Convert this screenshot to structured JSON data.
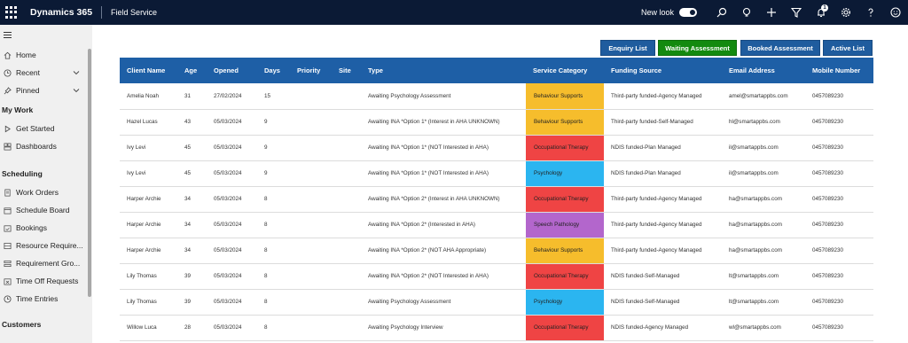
{
  "topbar": {
    "brand": "Dynamics 365",
    "app_name": "Field Service",
    "new_look_label": "New look",
    "notification_count": "1"
  },
  "sidebar": {
    "items_top": [
      {
        "label": "Home",
        "icon": "home-icon"
      },
      {
        "label": "Recent",
        "icon": "clock-icon"
      },
      {
        "label": "Pinned",
        "icon": "pin-icon"
      }
    ],
    "section_my_work": "My Work",
    "items_my_work": [
      {
        "label": "Get Started",
        "icon": "play-icon"
      },
      {
        "label": "Dashboards",
        "icon": "dashboard-icon"
      }
    ],
    "section_scheduling": "Scheduling",
    "items_scheduling": [
      {
        "label": "Work Orders",
        "icon": "document-icon"
      },
      {
        "label": "Schedule Board",
        "icon": "calendar-icon"
      },
      {
        "label": "Bookings",
        "icon": "calendar-check-icon"
      },
      {
        "label": "Resource Require...",
        "icon": "requirement-icon"
      },
      {
        "label": "Requirement Gro...",
        "icon": "group-icon"
      },
      {
        "label": "Time Off Requests",
        "icon": "calendar-x-icon"
      },
      {
        "label": "Time Entries",
        "icon": "clock-icon"
      }
    ],
    "section_customers": "Customers"
  },
  "buttons": {
    "enquiry": "Enquiry List",
    "waiting": "Waiting Assessment",
    "booked": "Booked Assessment",
    "active": "Active List"
  },
  "table": {
    "headers": [
      "Client Name",
      "Age",
      "Opened",
      "Days",
      "Priority",
      "Site",
      "Type",
      "Service Category",
      "Funding Source",
      "Email Address",
      "Mobile Number"
    ],
    "rows": [
      {
        "name": "Amelia Noah",
        "age": "31",
        "opened": "27/02/2024",
        "days": "15",
        "priority": "",
        "site": "",
        "type": "Awaiting Psychology Assessment",
        "category": "Behaviour Supports",
        "cat_color": "#f6bd2c",
        "funding": "Third-party funded-Agency Managed",
        "email": "amel@smartappbs.com",
        "mobile": "0457089230"
      },
      {
        "name": "Hazel Lucas",
        "age": "43",
        "opened": "05/03/2024",
        "days": "9",
        "priority": "",
        "site": "",
        "type": "Awaiting INA *Option 1* (Interest in AHA UNKNOWN)",
        "category": "Behaviour Supports",
        "cat_color": "#f6bd2c",
        "funding": "Third-party funded-Self-Managed",
        "email": "hl@smartappbs.com",
        "mobile": "0457089230"
      },
      {
        "name": "Ivy Levi",
        "age": "45",
        "opened": "05/03/2024",
        "days": "9",
        "priority": "",
        "site": "",
        "type": "Awaiting INA *Option 1* (NOT Interested in AHA)",
        "category": "Occupational Therapy",
        "cat_color": "#ef4444",
        "funding": "NDIS funded-Plan Managed",
        "email": "il@smartappbs.com",
        "mobile": "0457089230"
      },
      {
        "name": "Ivy Levi",
        "age": "45",
        "opened": "05/03/2024",
        "days": "9",
        "priority": "",
        "site": "",
        "type": "Awaiting INA *Option 1* (NOT Interested in AHA)",
        "category": "Psychology",
        "cat_color": "#2bb5f0",
        "funding": "NDIS funded-Plan Managed",
        "email": "il@smartappbs.com",
        "mobile": "0457089230"
      },
      {
        "name": "Harper Archie",
        "age": "34",
        "opened": "05/03/2024",
        "days": "8",
        "priority": "",
        "site": "",
        "type": "Awaiting INA *Option 2* (Interest in AHA UNKNOWN)",
        "category": "Occupational Therapy",
        "cat_color": "#ef4444",
        "funding": "Third-party funded-Agency Managed",
        "email": "ha@smartappbs.com",
        "mobile": "0457089230"
      },
      {
        "name": "Harper Archie",
        "age": "34",
        "opened": "05/03/2024",
        "days": "8",
        "priority": "",
        "site": "",
        "type": "Awaiting INA *Option 2* (Interested in AHA)",
        "category": "Speech Pathology",
        "cat_color": "#b366cc",
        "funding": "Third-party funded-Agency Managed",
        "email": "ha@smartappbs.com",
        "mobile": "0457089230"
      },
      {
        "name": "Harper Archie",
        "age": "34",
        "opened": "05/03/2024",
        "days": "8",
        "priority": "",
        "site": "",
        "type": "Awaiting INA *Option 2* (NOT AHA Appropriate)",
        "category": "Behaviour Supports",
        "cat_color": "#f6bd2c",
        "funding": "Third-party funded-Agency Managed",
        "email": "ha@smartappbs.com",
        "mobile": "0457089230"
      },
      {
        "name": "Lily Thomas",
        "age": "39",
        "opened": "05/03/2024",
        "days": "8",
        "priority": "",
        "site": "",
        "type": "Awaiting INA *Option 2* (NOT Interested in AHA)",
        "category": "Occupational Therapy",
        "cat_color": "#ef4444",
        "funding": "NDIS funded-Self-Managed",
        "email": "lt@smartappbs.com",
        "mobile": "0457089230"
      },
      {
        "name": "Lily Thomas",
        "age": "39",
        "opened": "05/03/2024",
        "days": "8",
        "priority": "",
        "site": "",
        "type": "Awaiting Psychology Assessment",
        "category": "Psychology",
        "cat_color": "#2bb5f0",
        "funding": "NDIS funded-Self-Managed",
        "email": "lt@smartappbs.com",
        "mobile": "0457089230"
      },
      {
        "name": "Willow Luca",
        "age": "28",
        "opened": "05/03/2024",
        "days": "8",
        "priority": "",
        "site": "",
        "type": "Awaiting Psychology Interview",
        "category": "Occupational Therapy",
        "cat_color": "#ef4444",
        "funding": "NDIS funded-Agency Managed",
        "email": "wl@smartappbs.com",
        "mobile": "0457089230"
      }
    ]
  }
}
